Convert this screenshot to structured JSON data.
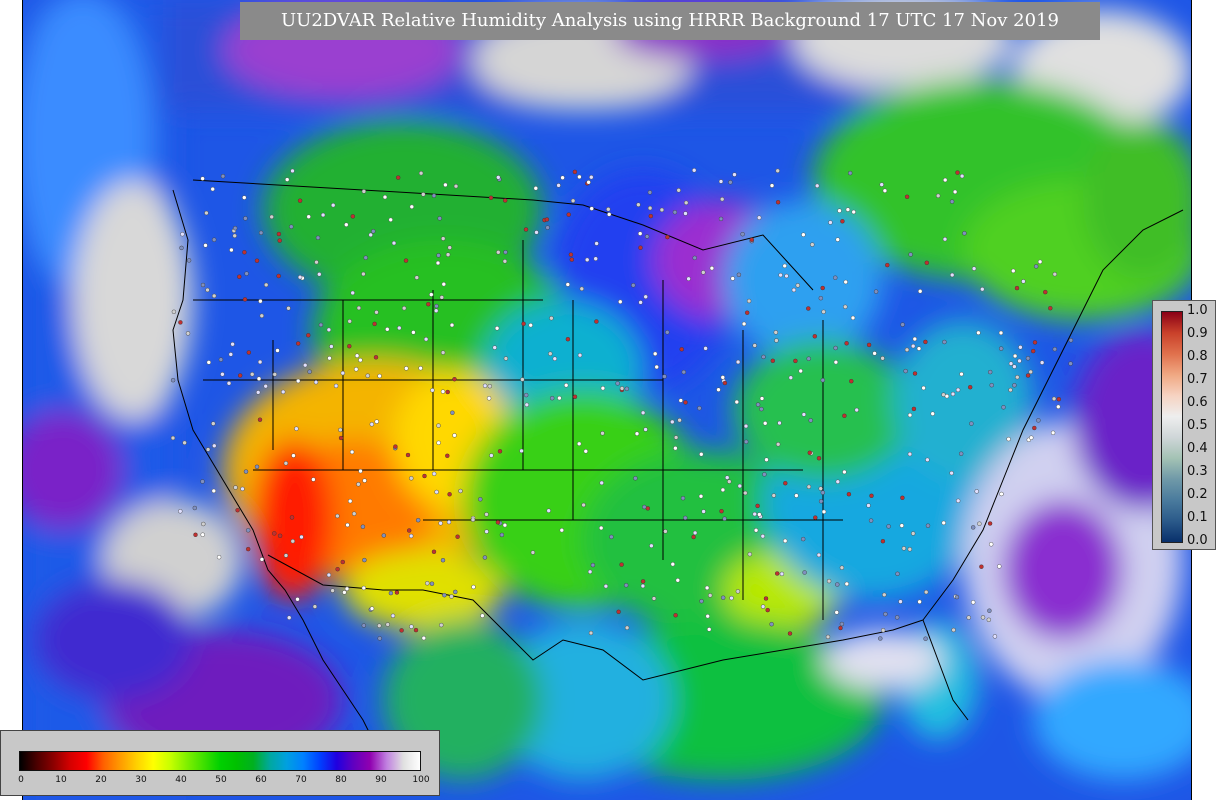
{
  "title": "UU2DVAR Relative Humidity Analysis using HRRR Background 17 UTC 17 Nov 2019",
  "map": {
    "region": "Continental United States",
    "variable": "Relative Humidity"
  },
  "rh_colorbar": {
    "ticks": [
      "0",
      "10",
      "20",
      "30",
      "40",
      "50",
      "60",
      "70",
      "80",
      "90",
      "100"
    ],
    "colors": [
      "#000000",
      "#4a0000",
      "#8b0000",
      "#d40000",
      "#ff0000",
      "#ff6000",
      "#ff9a00",
      "#ffd000",
      "#ffff00",
      "#c8ff00",
      "#80f000",
      "#40e000",
      "#00d000",
      "#00c000",
      "#00b020",
      "#00a8a0",
      "#00a0e0",
      "#0080ff",
      "#0040ff",
      "#2000e0",
      "#6000c0",
      "#9000b0",
      "#c080e0",
      "#e0e0e0",
      "#ffffff"
    ]
  },
  "qc_colorbar": {
    "ticks": [
      "0.0",
      "0.1",
      "0.2",
      "0.3",
      "0.4",
      "0.5",
      "0.6",
      "0.7",
      "0.8",
      "0.9",
      "1.0"
    ],
    "colors": [
      "#08306b",
      "#2b5a8a",
      "#4a7b9d",
      "#6f99a8",
      "#a3c2b4",
      "#cfd6d8",
      "#eeeeee",
      "#f6d3c2",
      "#f0a883",
      "#e0714d",
      "#c9412a",
      "#8b0015"
    ]
  }
}
